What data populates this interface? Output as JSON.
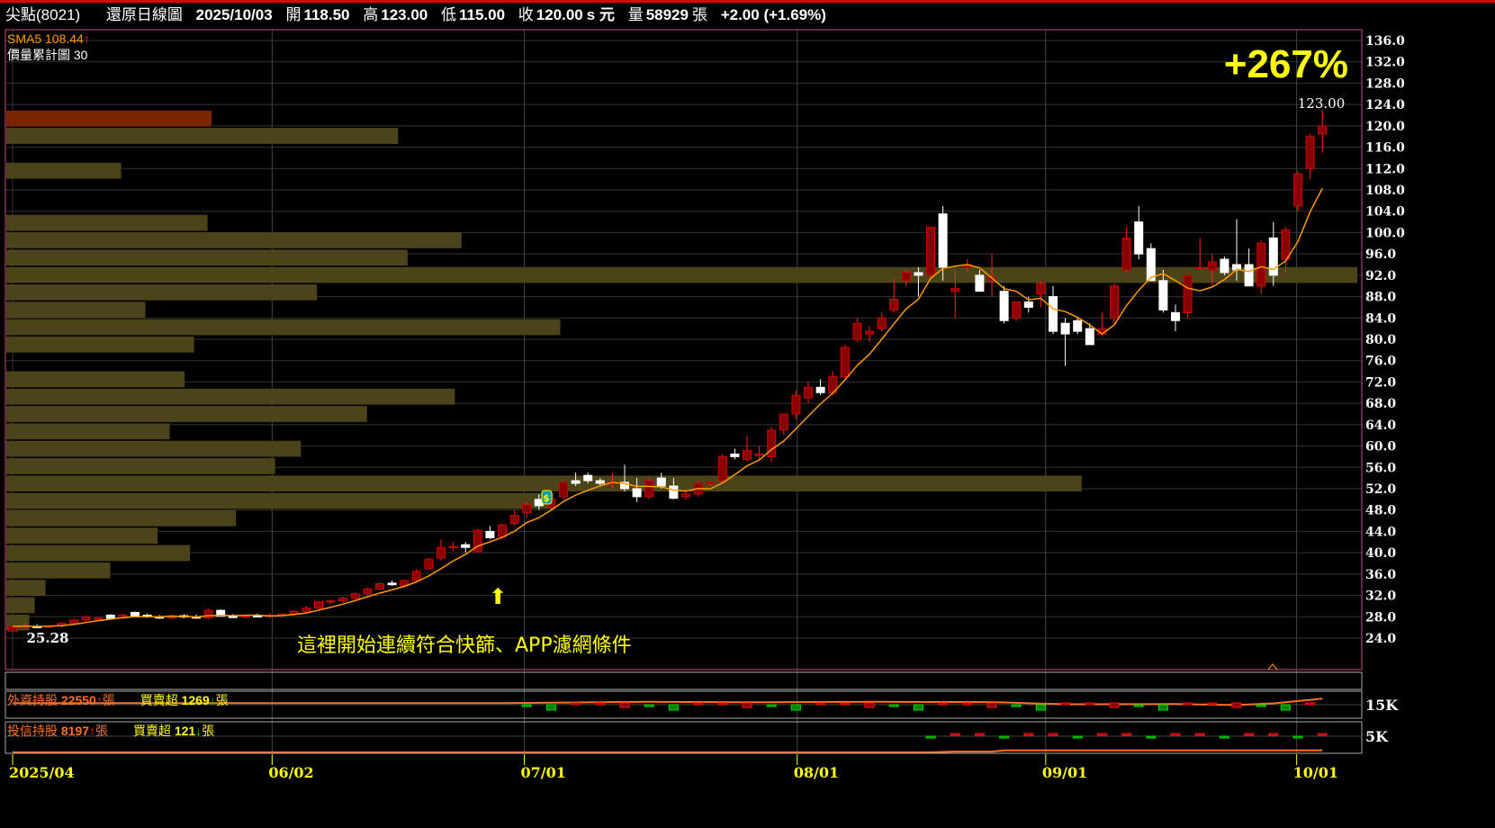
{
  "header": {
    "name": "尖點(8021)",
    "chart_type": "還原日線圖",
    "date": "2025/10/03",
    "open_label": "開",
    "open": "118.50",
    "high_label": "高",
    "high": "123.00",
    "low_label": "低",
    "low": "115.00",
    "close_label": "收",
    "close": "120.00",
    "unit": "s 元",
    "vol_label": "量",
    "volume": "58929",
    "vol_unit": "張",
    "change": "+2.00 (+1.69%)"
  },
  "indicators": {
    "sma_label": "SMA5 108.44",
    "sma_arrow": "↑",
    "profile_label": "價量累計圖 30"
  },
  "annotations": {
    "gain": "+267%",
    "high_value": "123.00",
    "low_value": "25.28",
    "note": "這裡開始連續符合快篩、APP濾網條件",
    "arrow": "⬆",
    "marker": "$"
  },
  "colors": {
    "up": "#d00000",
    "down": "#ffffff",
    "sma": "#ff9900",
    "profile": "#4a4418",
    "profile_top": "#7a2400",
    "accent": "#ffff00"
  },
  "foreign": {
    "label": "外資持股",
    "value": "22550",
    "arrow": "↑",
    "unit": "張",
    "net_label": "買賣超",
    "net": "1269",
    "net_arrow": "↓",
    "net_unit": "張"
  },
  "trust": {
    "label": "投信持股",
    "value": "8197",
    "arrow": "↑",
    "unit": "張",
    "net_label": "買賣超",
    "net": "121",
    "net_arrow": "↓",
    "net_unit": "張"
  },
  "chart_data": {
    "type": "candlestick",
    "ylim": [
      24,
      136
    ],
    "yticks": [
      "136.0",
      "132.0",
      "128.0",
      "124.0",
      "120.0",
      "116.0",
      "112.0",
      "108.0",
      "104.0",
      "100.0",
      "96.0",
      "92.0",
      "88.0",
      "84.0",
      "80.0",
      "76.0",
      "72.0",
      "68.0",
      "64.0",
      "60.0",
      "56.0",
      "52.0",
      "48.0",
      "44.0",
      "40.0",
      "36.0",
      "32.0",
      "28.0",
      "24.0"
    ],
    "xticks": [
      {
        "label": "2025/04",
        "index": 0
      },
      {
        "label": "06/02",
        "index": 21.2
      },
      {
        "label": "07/01",
        "index": 41.8
      },
      {
        "label": "08/01",
        "index": 64.1
      },
      {
        "label": "09/01",
        "index": 84.4
      },
      {
        "label": "10/01",
        "index": 104.9
      }
    ],
    "sub_ticks": [
      "15K",
      "5K"
    ],
    "ohlc": [
      [
        25.3,
        26.5,
        25.28,
        26.2
      ],
      [
        26,
        26.8,
        25.8,
        26.3
      ],
      [
        26.2,
        26.6,
        25.9,
        26.1
      ],
      [
        26.1,
        26.5,
        25.9,
        26.3
      ],
      [
        26.3,
        27,
        26,
        26.8
      ],
      [
        26.8,
        27.6,
        26.5,
        27.4
      ],
      [
        27.4,
        28.2,
        27,
        28
      ],
      [
        27.5,
        28,
        27.2,
        27.8
      ],
      [
        28.3,
        28.5,
        27.6,
        27.7
      ],
      [
        27.8,
        28.6,
        27.5,
        28.3
      ],
      [
        28.8,
        29,
        28,
        28.2
      ],
      [
        28.3,
        28.6,
        27.8,
        28
      ],
      [
        28,
        28.3,
        27.6,
        27.8
      ],
      [
        27.8,
        28.4,
        27.5,
        28.2
      ],
      [
        28.2,
        28.5,
        27.7,
        28
      ],
      [
        28,
        28.4,
        27.6,
        27.8
      ],
      [
        27.8,
        29.5,
        27.5,
        29.2
      ],
      [
        29.2,
        29.4,
        28,
        28.1
      ],
      [
        28.1,
        28.5,
        27.8,
        28
      ],
      [
        28,
        28.4,
        27.7,
        28.2
      ],
      [
        28.2,
        28.6,
        27.9,
        28.1
      ],
      [
        28.1,
        28.6,
        27.8,
        28.3
      ],
      [
        28.3,
        28.7,
        28,
        28.5
      ],
      [
        28.5,
        29.2,
        28.2,
        29
      ],
      [
        29,
        30,
        28.8,
        29.6
      ],
      [
        29.6,
        31,
        29.4,
        30.8
      ],
      [
        30.8,
        31.2,
        30.3,
        31
      ],
      [
        31,
        31.8,
        30.6,
        31.5
      ],
      [
        31.5,
        32.6,
        31.2,
        32.3
      ],
      [
        32.3,
        33.5,
        32,
        33.2
      ],
      [
        33.2,
        34.5,
        33,
        34.2
      ],
      [
        34.3,
        34.8,
        33.8,
        34
      ],
      [
        33.8,
        35,
        33.5,
        34.8
      ],
      [
        34.8,
        37,
        34.5,
        36.5
      ],
      [
        37,
        39,
        36.8,
        38.8
      ],
      [
        39,
        42.5,
        38.5,
        41
      ],
      [
        41,
        42,
        40.3,
        41.2
      ],
      [
        41.5,
        42,
        40,
        41
      ],
      [
        40.2,
        44.5,
        40,
        44.2
      ],
      [
        44,
        45,
        42.5,
        42.8
      ],
      [
        43,
        45.5,
        42.5,
        45.2
      ],
      [
        45.5,
        48,
        45,
        47
      ],
      [
        47.5,
        49.5,
        46.5,
        49
      ],
      [
        50,
        51,
        48,
        48.8
      ],
      [
        48.5,
        50.5,
        48,
        50
      ],
      [
        50.5,
        53.5,
        50,
        53.2
      ],
      [
        53.5,
        55,
        52.5,
        53
      ],
      [
        54.5,
        55,
        53,
        53.5
      ],
      [
        53.5,
        54,
        52.5,
        53
      ],
      [
        53,
        55,
        52,
        53.2
      ],
      [
        53.2,
        56.5,
        51.5,
        52
      ],
      [
        52,
        54,
        49.5,
        50.5
      ],
      [
        50.5,
        54,
        50,
        53.5
      ],
      [
        54,
        55,
        52,
        52.5
      ],
      [
        52.5,
        54,
        50,
        50.2
      ],
      [
        50.5,
        52,
        50,
        51
      ],
      [
        51,
        53.5,
        50.5,
        53
      ],
      [
        53,
        53.5,
        52.5,
        53.2
      ],
      [
        53.5,
        58.5,
        53,
        58
      ],
      [
        58.5,
        59.5,
        57.5,
        58
      ],
      [
        57.5,
        62,
        57,
        59.2
      ],
      [
        58.5,
        60,
        57.5,
        58.5
      ],
      [
        58,
        63.5,
        57,
        63
      ],
      [
        63,
        66,
        62,
        66
      ],
      [
        66,
        70.5,
        65,
        69.5
      ],
      [
        69,
        72,
        68,
        71
      ],
      [
        71,
        72.5,
        69.5,
        70
      ],
      [
        70,
        74,
        69.5,
        73
      ],
      [
        73,
        79,
        72.5,
        78.5
      ],
      [
        80,
        84,
        79.5,
        83
      ],
      [
        81,
        82.5,
        79.5,
        81.5
      ],
      [
        82,
        85,
        81.5,
        84
      ],
      [
        85.5,
        91.5,
        85,
        87.5
      ],
      [
        91,
        93,
        90,
        92.5
      ],
      [
        92.5,
        93.5,
        88,
        92
      ],
      [
        92,
        101,
        91.5,
        101
      ],
      [
        103.5,
        105,
        91,
        93.5
      ],
      [
        89,
        93,
        84,
        89.5
      ],
      [
        93.5,
        95,
        92.5,
        94
      ],
      [
        92,
        93,
        89,
        89
      ],
      [
        91,
        96,
        88,
        91.5
      ],
      [
        89,
        90,
        83,
        83.5
      ],
      [
        84,
        87,
        83.5,
        87
      ],
      [
        87,
        88,
        85,
        86
      ],
      [
        88.5,
        91,
        86,
        90.5
      ],
      [
        88,
        90,
        81,
        81.5
      ],
      [
        83,
        84,
        75,
        81
      ],
      [
        83.5,
        84,
        81,
        81.5
      ],
      [
        82,
        83,
        79,
        79
      ],
      [
        81,
        85,
        80.5,
        82
      ],
      [
        84,
        90.5,
        83,
        90
      ],
      [
        93,
        101,
        92.5,
        99
      ],
      [
        102,
        105,
        95,
        96
      ],
      [
        97,
        98,
        91,
        91
      ],
      [
        91,
        93,
        85,
        85.5
      ],
      [
        85,
        86.5,
        81.5,
        83.5
      ],
      [
        85,
        92,
        84,
        92
      ],
      [
        93.5,
        99,
        93,
        93.5
      ],
      [
        93,
        96,
        90,
        94.5
      ],
      [
        95,
        95.5,
        92,
        92.5
      ],
      [
        94,
        102.5,
        91,
        93
      ],
      [
        94,
        97,
        90,
        90
      ],
      [
        90,
        98.5,
        88.5,
        98
      ],
      [
        99,
        102,
        90,
        92
      ],
      [
        95,
        101,
        92.5,
        100.5
      ],
      [
        105,
        111.5,
        104,
        111
      ],
      [
        112,
        118.5,
        110,
        118
      ],
      [
        118.5,
        123,
        115,
        120
      ]
    ],
    "volume_profile": {
      "bins": 30,
      "price_low": 25.28,
      "price_high": 123,
      "relative_volume_pct": [
        1.7,
        2.1,
        2.9,
        7.7,
        13.6,
        11.2,
        17,
        40.5,
        79.6,
        19.9,
        21.8,
        12.1,
        26.7,
        33.2,
        13.2,
        0,
        13.9,
        41,
        10.3,
        23,
        100,
        29.7,
        33.7,
        14.9,
        0,
        0,
        8.5,
        0,
        29,
        15.2
      ]
    },
    "foreign_holdings_k": [
      [
        0,
        17
      ],
      [
        40,
        17
      ],
      [
        45,
        17.6
      ],
      [
        52,
        18.6
      ],
      [
        60,
        18
      ],
      [
        70,
        18.6
      ],
      [
        80,
        18.2
      ],
      [
        86,
        15.5
      ],
      [
        95,
        15.8
      ],
      [
        100,
        14.6
      ],
      [
        103,
        16.6
      ],
      [
        107,
        22.5
      ]
    ],
    "trust_holdings_k": [
      [
        0,
        0.5
      ],
      [
        75,
        0.5
      ],
      [
        77,
        3
      ],
      [
        80,
        3.3
      ],
      [
        81,
        8
      ],
      [
        103,
        8
      ],
      [
        104,
        8.2
      ],
      [
        107,
        8.2
      ]
    ]
  }
}
